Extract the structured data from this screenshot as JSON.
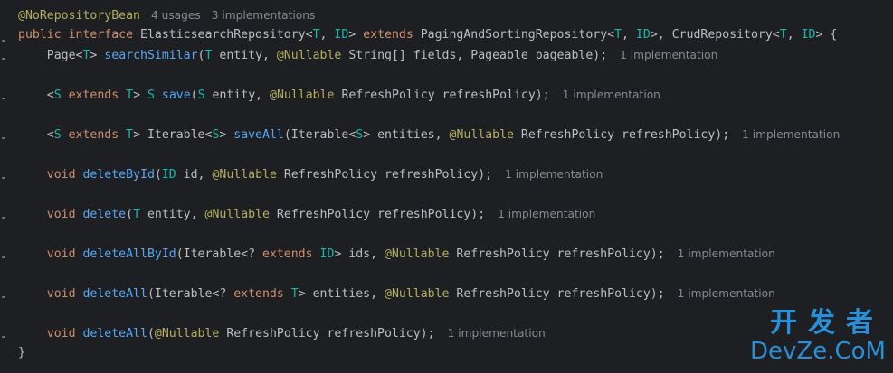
{
  "hints": {
    "usages": "4 usages",
    "implementations": "3 implementations",
    "one_impl": "1 implementation"
  },
  "code": {
    "annotation": "@NoRepositoryBean",
    "l1": {
      "public": "public",
      "interface": "interface",
      "name": " ElasticsearchRepository<",
      "T": "T",
      "comma1": ", ",
      "ID": "ID",
      "close1": "> ",
      "extends": "extends",
      "paging": " PagingAndSortingRepository<",
      "T2": "T",
      "comma2": ", ",
      "ID2": "ID",
      "crud": ">, CrudRepository<",
      "T3": "T",
      "comma3": ", ",
      "ID3": "ID",
      "end": "> {"
    },
    "m1": {
      "pre": "    Page<",
      "T": "T",
      "mid": "> ",
      "name": "searchSimilar",
      "a": "(",
      "T2": "T",
      "b": " entity, ",
      "nullable": "@Nullable",
      "c": " String[] fields, Pageable pageable);"
    },
    "m2": {
      "pre": "    <",
      "S": "S",
      "sp": " ",
      "extends": "extends",
      "sp2": " ",
      "T": "T",
      "mid": "> ",
      "S2": "S",
      "sp3": " ",
      "name": "save",
      "a": "(",
      "S3": "S",
      "b": " entity, ",
      "nullable": "@Nullable",
      "c": " RefreshPolicy refreshPolicy);"
    },
    "m3": {
      "pre": "    <",
      "S": "S",
      "sp": " ",
      "extends": "extends",
      "sp2": " ",
      "T": "T",
      "mid": "> Iterable<",
      "S2": "S",
      "mid2": "> ",
      "name": "saveAll",
      "a": "(Iterable<",
      "S3": "S",
      "b": "> entities, ",
      "nullable": "@Nullable",
      "c": " RefreshPolicy refreshPolicy);"
    },
    "m4": {
      "void": "void",
      "name": "deleteById",
      "a": "(",
      "ID": "ID",
      "b": " id, ",
      "nullable": "@Nullable",
      "c": " RefreshPolicy refreshPolicy);"
    },
    "m5": {
      "void": "void",
      "name": "delete",
      "a": "(",
      "T": "T",
      "b": " entity, ",
      "nullable": "@Nullable",
      "c": " RefreshPolicy refreshPolicy);"
    },
    "m6": {
      "void": "void",
      "name": "deleteAllById",
      "a": "(Iterable<? ",
      "extends": "extends",
      "sp": " ",
      "ID": "ID",
      "b": "> ids, ",
      "nullable": "@Nullable",
      "c": " RefreshPolicy refreshPolicy);"
    },
    "m7": {
      "void": "void",
      "name": "deleteAll",
      "a": "(Iterable<? ",
      "extends": "extends",
      "sp": " ",
      "T": "T",
      "b": "> entities, ",
      "nullable": "@Nullable",
      "c": " RefreshPolicy refreshPolicy);"
    },
    "m8": {
      "void": "void",
      "name": "deleteAll",
      "a": "(",
      "nullable": "@Nullable",
      "c": " RefreshPolicy refreshPolicy);"
    },
    "close": "}"
  },
  "watermark": {
    "cn": "开发者",
    "en": "DevZe.CoM"
  }
}
